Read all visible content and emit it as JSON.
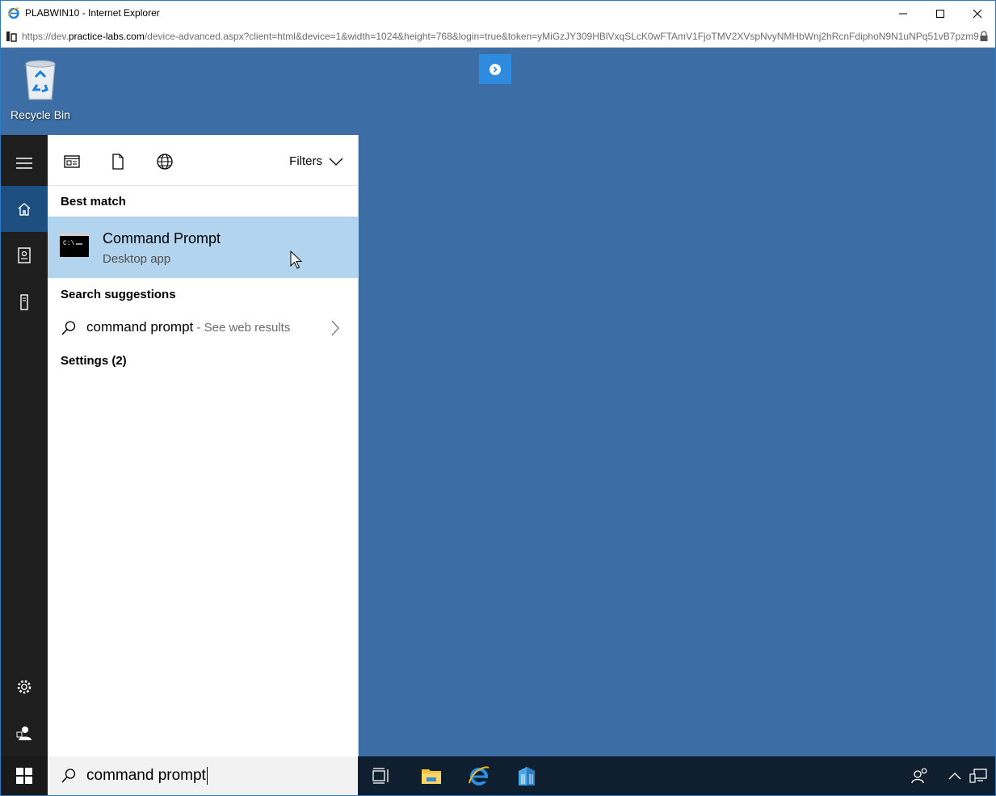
{
  "window": {
    "title": "PLABWIN10 - Internet Explorer",
    "controls": [
      "minimize",
      "maximize",
      "close"
    ]
  },
  "address_bar": {
    "url_prefix": "https://dev.",
    "url_host": "practice-labs.com",
    "url_path": "/device-advanced.aspx?client=html&device=1&width=1024&height=768&login=true&token=yMiGzJY309HBlVxqSLcK0wFTAmV1FjoTMV2XVspNvyNMHbWnj2hRcnFdiphoN9N1uNPq51vB7pzm9"
  },
  "desktop": {
    "background": "#3c6ea5",
    "icons": [
      {
        "label": "Recycle Bin",
        "icon": "recycle-bin-icon"
      }
    ]
  },
  "start_rail": {
    "items": [
      {
        "name": "hamburger-menu",
        "icon": "hamburger-icon"
      },
      {
        "name": "home",
        "icon": "home-icon",
        "active": true
      },
      {
        "name": "documents",
        "icon": "notebook-icon"
      },
      {
        "name": "devices",
        "icon": "tower-icon"
      },
      {
        "name": "settings",
        "icon": "gear-icon"
      },
      {
        "name": "user",
        "icon": "user-icon"
      }
    ]
  },
  "search_pane": {
    "filters_label": "Filters",
    "best_match_label": "Best match",
    "best_match": {
      "title": "Command Prompt",
      "subtitle": "Desktop app"
    },
    "suggestions_label": "Search suggestions",
    "suggestion": {
      "query": "command prompt",
      "suffix": " - See web results"
    },
    "settings_label": "Settings (2)"
  },
  "taskbar": {
    "search_value": "command prompt",
    "pinned": [
      "task-view-icon",
      "file-explorer-icon",
      "internet-explorer-icon",
      "server-manager-icon"
    ],
    "tray": [
      "people-icon",
      "chevron-up-icon",
      "network-icon"
    ]
  },
  "colors": {
    "accent": "#2e8be0",
    "selection": "#b3d4ef",
    "rail": "#1e1e1e",
    "taskbar": "#101f30"
  }
}
